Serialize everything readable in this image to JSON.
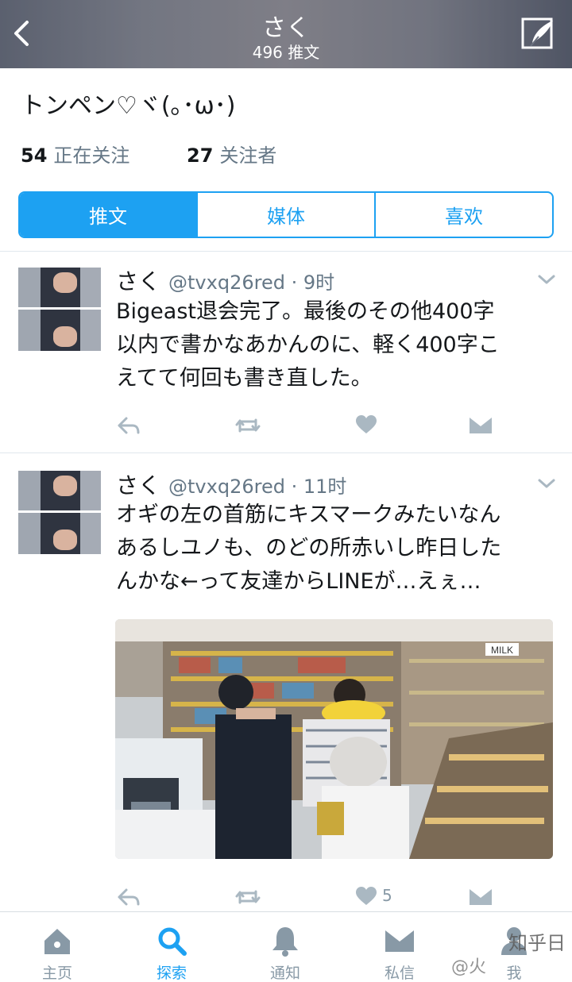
{
  "header": {
    "title": "さく",
    "subtitle": "496 推文"
  },
  "profile": {
    "bio": "トンペン♡ヾ(｡･ω･)",
    "following_count": "54",
    "following_label": "正在关注",
    "followers_count": "27",
    "followers_label": "关注者"
  },
  "tabs": [
    {
      "label": "推文",
      "active": true
    },
    {
      "label": "媒体",
      "active": false
    },
    {
      "label": "喜欢",
      "active": false
    }
  ],
  "tweets": [
    {
      "name": "さく",
      "handle": "@tvxq26red · 9时",
      "lines": [
        "Bigeast退会完了。最後のその他400字",
        "以内で書かなあかんのに、軽く400字こ",
        "えてて何回も書き直した。"
      ],
      "like_count": ""
    },
    {
      "name": "さく",
      "handle": "@tvxq26red · 11时",
      "lines": [
        "オギの左の首筋にキスマークみたいなん",
        "あるしユノも、のどの所赤いし昨日した",
        "んかな←って友達からLINEが…えぇ…"
      ],
      "photo_sign": "MILK",
      "like_count": "5"
    }
  ],
  "tabbar": [
    {
      "label": "主页",
      "icon": "home-icon",
      "active": false
    },
    {
      "label": "探索",
      "icon": "search-icon",
      "active": true
    },
    {
      "label": "通知",
      "icon": "bell-icon",
      "active": false
    },
    {
      "label": "私信",
      "icon": "mail-icon",
      "active": false
    },
    {
      "label": "我",
      "icon": "profile-icon",
      "active": false
    }
  ],
  "watermark": {
    "text1": "知乎日",
    "text2": "@火"
  },
  "colors": {
    "accent": "#1da1f2",
    "muted": "#8899a6",
    "text": "#14171a"
  }
}
